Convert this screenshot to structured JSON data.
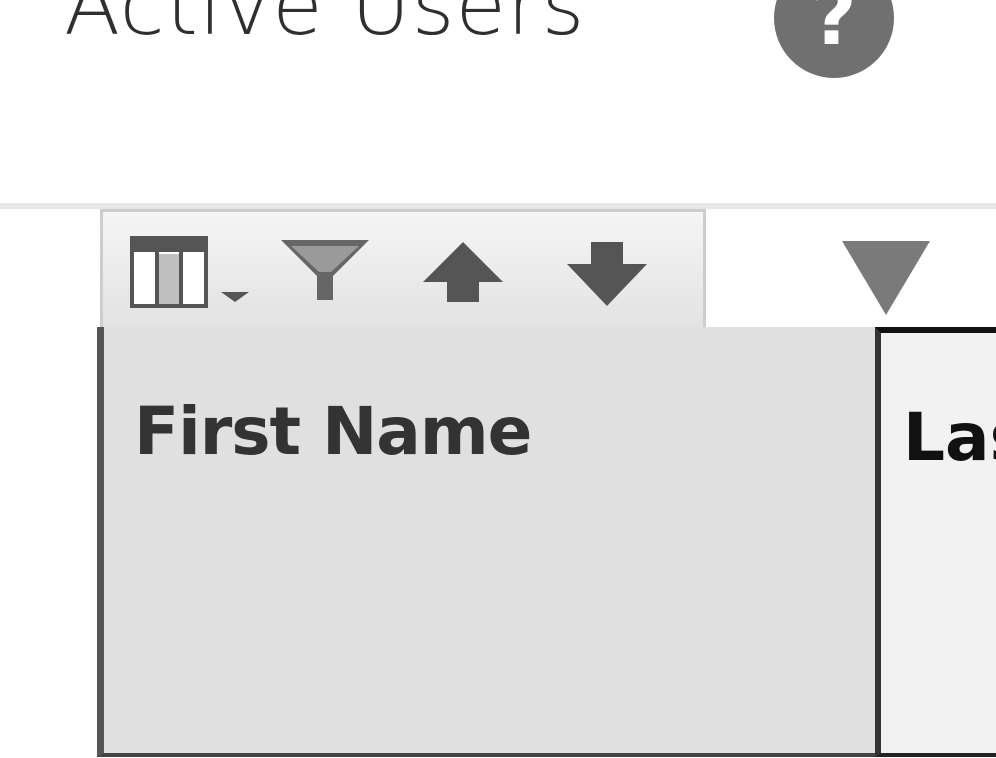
{
  "page": {
    "title": "Active Users",
    "help_glyph": "?"
  },
  "toolbar": {
    "buttons": [
      {
        "name": "columns-menu",
        "icon": "columns-icon"
      },
      {
        "name": "filter",
        "icon": "funnel-icon"
      },
      {
        "name": "sort-ascending",
        "icon": "arrow-up-icon"
      },
      {
        "name": "sort-descending",
        "icon": "arrow-down-icon"
      }
    ]
  },
  "grid": {
    "columns": [
      {
        "label": "First Name"
      },
      {
        "label": "Last Name"
      }
    ],
    "sort_indicator_icon": "triangle-down-icon"
  },
  "colors": {
    "title_text": "#2f2f2f",
    "help_badge": "#707070",
    "header_bg": "#e0e0e0",
    "icon_gray": "#555555"
  }
}
